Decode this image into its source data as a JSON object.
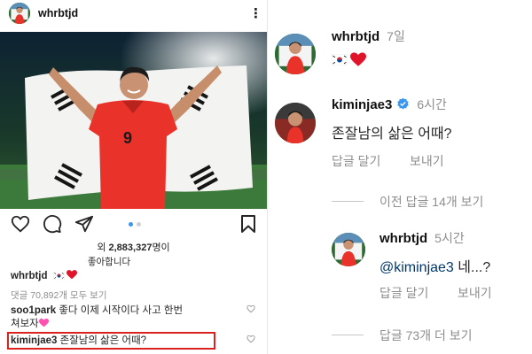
{
  "post": {
    "username": "whrbtjd",
    "more_label": "⋮",
    "viewers_prefix": "외 ",
    "viewers_count": "2,883,327",
    "viewers_suffix": "명이",
    "likes_label": "좋아합니다",
    "caption_user": "whrbtjd",
    "view_all_comments": "댓글 70,892개 모두 보기",
    "comments": [
      {
        "user": "soo1park",
        "text": " 좋다 이제 시작이다 사고 한번",
        "text2": "쳐보자"
      },
      {
        "user": "kiminjae3",
        "text": " 존잘남의 삶은 어때?"
      }
    ],
    "carousel": {
      "count": 2,
      "active": 0
    }
  },
  "thread": {
    "top": {
      "user": "whrbtjd",
      "time": "7일"
    },
    "reply1": {
      "user": "kiminjae3",
      "time": "6시간",
      "text": "존잘남의 삶은 어때?",
      "reply_label": "답글 달기",
      "send_label": "보내기"
    },
    "prev_replies": "이전 답글 14개 보기",
    "reply2": {
      "user": "whrbtjd",
      "time": "5시간",
      "mention": "@kiminjae3",
      "text": " 네...?",
      "reply_label": "답글 달기",
      "send_label": "보내기"
    },
    "more_replies": "답글 73개 더 보기"
  },
  "colors": {
    "highlight_box": "#d9231e",
    "link": "#00376b",
    "verified": "#3897f0",
    "jersey": "#e8322a"
  },
  "icons": [
    "heart-icon",
    "comment-icon",
    "share-icon",
    "bookmark-icon",
    "more-options-icon",
    "verified-badge-icon"
  ]
}
